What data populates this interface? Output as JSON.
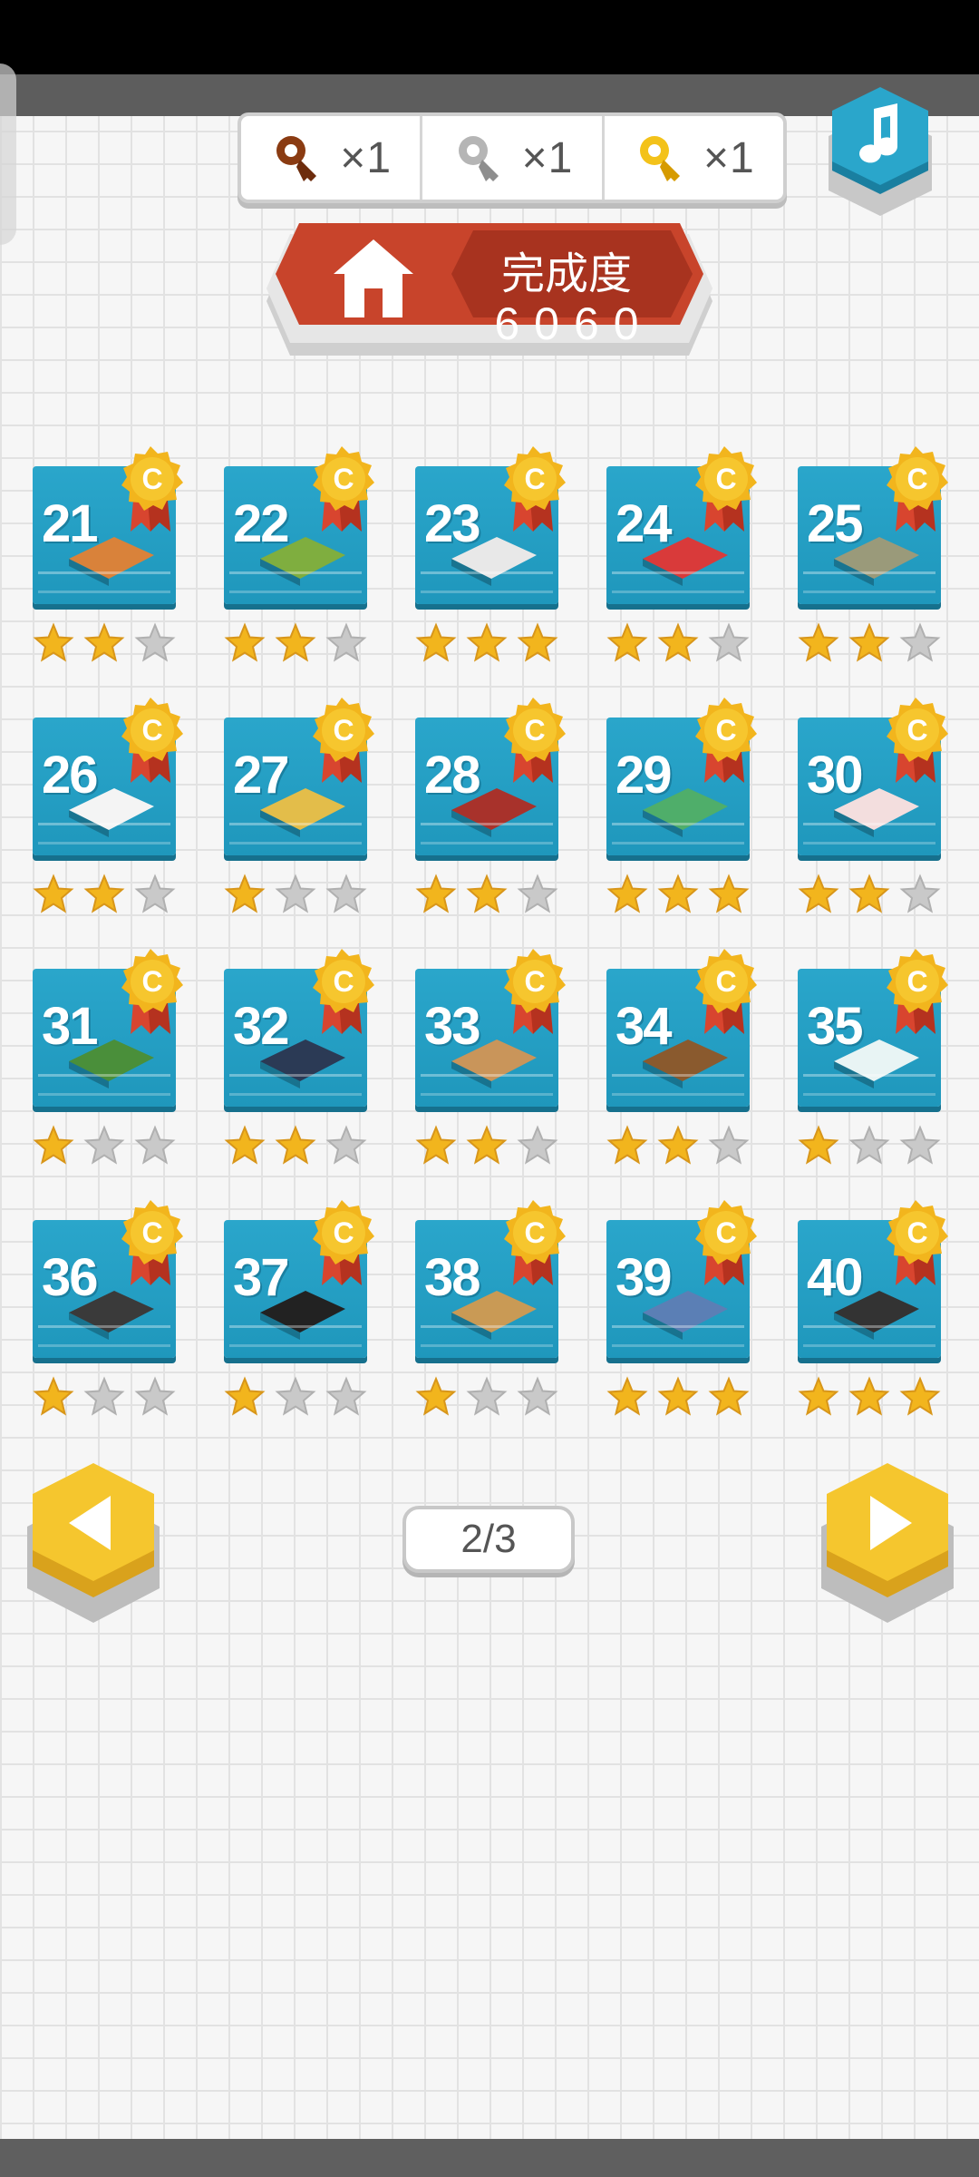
{
  "keys": [
    {
      "icon": "bronze-key-icon",
      "color": "#8a3b12",
      "count": "×1"
    },
    {
      "icon": "silver-key-icon",
      "color": "#a8a8a8",
      "count": "×1"
    },
    {
      "icon": "gold-key-icon",
      "color": "#f3c21a",
      "count": "×1"
    }
  ],
  "progress": {
    "label": "完成度",
    "value": "6060"
  },
  "medal_letter": "C",
  "levels": [
    {
      "number": "21",
      "stars": 2
    },
    {
      "number": "22",
      "stars": 2
    },
    {
      "number": "23",
      "stars": 3
    },
    {
      "number": "24",
      "stars": 2
    },
    {
      "number": "25",
      "stars": 2
    },
    {
      "number": "26",
      "stars": 2
    },
    {
      "number": "27",
      "stars": 1
    },
    {
      "number": "28",
      "stars": 2
    },
    {
      "number": "29",
      "stars": 3
    },
    {
      "number": "30",
      "stars": 2
    },
    {
      "number": "31",
      "stars": 1
    },
    {
      "number": "32",
      "stars": 2
    },
    {
      "number": "33",
      "stars": 2
    },
    {
      "number": "34",
      "stars": 2
    },
    {
      "number": "35",
      "stars": 1
    },
    {
      "number": "36",
      "stars": 1
    },
    {
      "number": "37",
      "stars": 1
    },
    {
      "number": "38",
      "stars": 1
    },
    {
      "number": "39",
      "stars": 3
    },
    {
      "number": "40",
      "stars": 3
    }
  ],
  "pagination": {
    "text": "2/3"
  },
  "colors": {
    "tile": "#1f97bc",
    "star_on": "#f2b51d",
    "star_off": "#c9c9c9",
    "accent_red": "#c8442b",
    "nav_yellow": "#f5c62e",
    "music_blue": "#2aa6cb"
  }
}
